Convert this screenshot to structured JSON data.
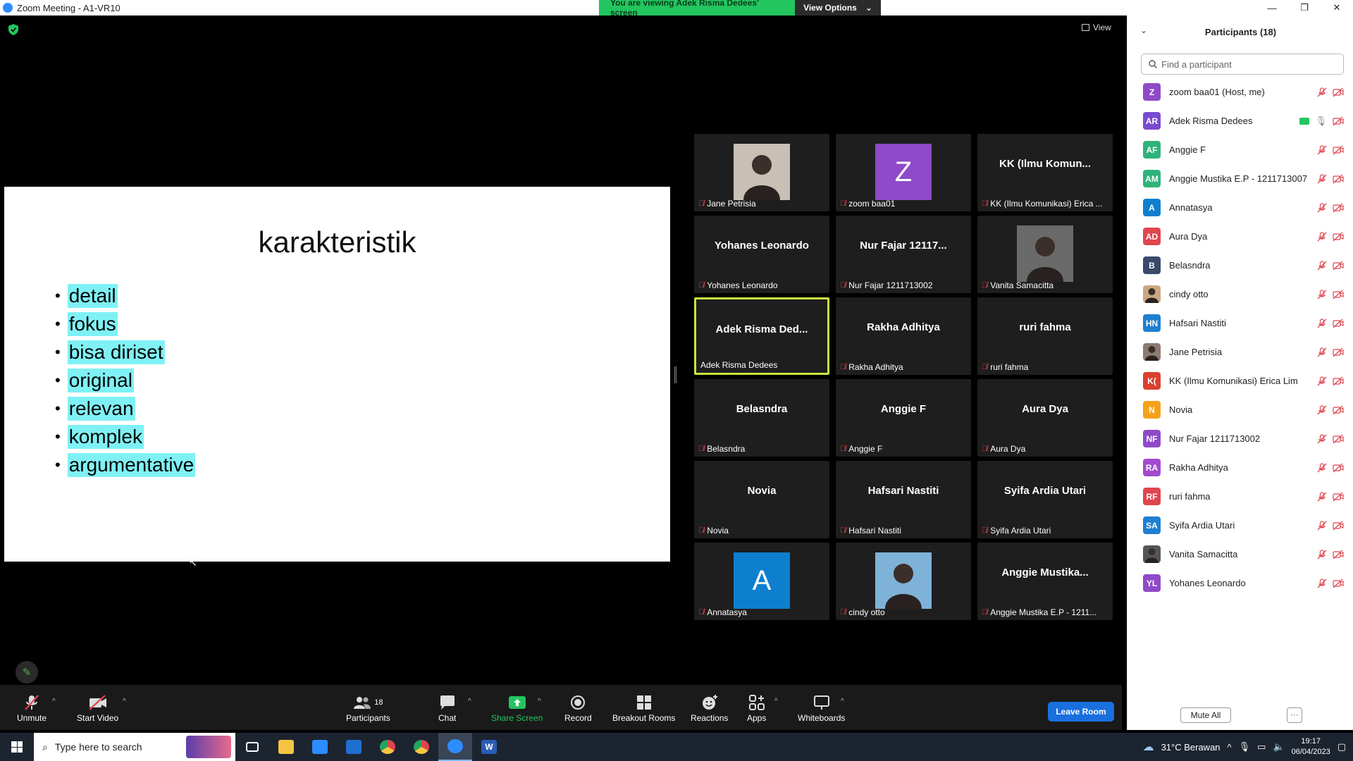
{
  "window": {
    "title": "Zoom Meeting - A1-VR10",
    "minimize": "—",
    "restore": "❐",
    "close": "✕"
  },
  "banner": {
    "viewing_text": "You are viewing Adek Risma Dedees' screen",
    "view_options": "View Options"
  },
  "view_button": "View",
  "slide": {
    "title": "karakteristik",
    "bullets": [
      "detail",
      "fokus",
      "bisa diriset",
      "original",
      "relevan",
      "komplek",
      "argumentative"
    ],
    "highlight_color": "#7ff1f5"
  },
  "gallery": [
    {
      "display": "",
      "label": "Jane Petrisia",
      "type": "photo"
    },
    {
      "display": "Z",
      "label": "zoom baa01",
      "type": "avatar",
      "color": "#8e4ac8"
    },
    {
      "display": "KK (Ilmu Komun...",
      "label": "KK (Ilmu Komunikasi) Erica ...",
      "type": "name"
    },
    {
      "display": "Yohanes Leonardo",
      "label": "Yohanes Leonardo",
      "type": "name"
    },
    {
      "display": "Nur Fajar 12117...",
      "label": "Nur Fajar 1211713002",
      "type": "name"
    },
    {
      "display": "",
      "label": "Vanita Samacitta",
      "type": "photo"
    },
    {
      "display": "Adek Risma Ded...",
      "label": "Adek Risma Dedees",
      "type": "name",
      "active": true
    },
    {
      "display": "Rakha Adhitya",
      "label": "Rakha Adhitya",
      "type": "name"
    },
    {
      "display": "ruri fahma",
      "label": "ruri fahma",
      "type": "name"
    },
    {
      "display": "Belasndra",
      "label": "Belasndra",
      "type": "name"
    },
    {
      "display": "Anggie F",
      "label": "Anggie F",
      "type": "name"
    },
    {
      "display": "Aura Dya",
      "label": "Aura Dya",
      "type": "name"
    },
    {
      "display": "Novia",
      "label": "Novia",
      "type": "name"
    },
    {
      "display": "Hafsari Nastiti",
      "label": "Hafsari Nastiti",
      "type": "name"
    },
    {
      "display": "Syifa Ardia Utari",
      "label": "Syifa Ardia Utari",
      "type": "name"
    },
    {
      "display": "A",
      "label": "Annatasya",
      "type": "avatar",
      "color": "#0e7fcf"
    },
    {
      "display": "",
      "label": "cindy otto",
      "type": "photo"
    },
    {
      "display": "Anggie Mustika...",
      "label": "Anggie Mustika E.P - 1211...",
      "type": "name"
    }
  ],
  "toolbar": {
    "unmute": "Unmute",
    "start_video": "Start Video",
    "participants": "Participants",
    "participants_count": "18",
    "chat": "Chat",
    "share_screen": "Share Screen",
    "record": "Record",
    "breakout_rooms": "Breakout Rooms",
    "reactions": "Reactions",
    "apps": "Apps",
    "whiteboards": "Whiteboards",
    "leave_room": "Leave Room"
  },
  "panel": {
    "title": "Participants (18)",
    "search_placeholder": "Find a participant",
    "mute_all": "Mute All",
    "more": "···",
    "participants": [
      {
        "initials": "Z",
        "name": "zoom baa01 (Host, me)",
        "color": "#8e4ac8"
      },
      {
        "initials": "AR",
        "name": "Adek Risma Dedees",
        "color": "#7a4ad0",
        "sharing": true
      },
      {
        "initials": "AF",
        "name": "Anggie F",
        "color": "#2eb37a"
      },
      {
        "initials": "AM",
        "name": "Anggie Mustika E.P - 1211713007",
        "color": "#2eb37a"
      },
      {
        "initials": "A",
        "name": "Annatasya",
        "color": "#0e7fcf"
      },
      {
        "initials": "AD",
        "name": "Aura Dya",
        "color": "#e0454e"
      },
      {
        "initials": "B",
        "name": "Belasndra",
        "color": "#3a4a6a"
      },
      {
        "initials": "",
        "name": "cindy otto",
        "color": "#c9a880",
        "photo": true
      },
      {
        "initials": "HN",
        "name": "Hafsari Nastiti",
        "color": "#1f7fd0"
      },
      {
        "initials": "",
        "name": "Jane Petrisia",
        "color": "#8c7b70",
        "photo": true
      },
      {
        "initials": "K(",
        "name": "KK (Ilmu Komunikasi) Erica Lim",
        "color": "#d9402e"
      },
      {
        "initials": "N",
        "name": "Novia",
        "color": "#f5a11a"
      },
      {
        "initials": "NF",
        "name": "Nur Fajar 1211713002",
        "color": "#8e4ac8"
      },
      {
        "initials": "RA",
        "name": "Rakha Adhitya",
        "color": "#a34ad0"
      },
      {
        "initials": "RF",
        "name": "ruri fahma",
        "color": "#e0454e"
      },
      {
        "initials": "SA",
        "name": "Syifa Ardia Utari",
        "color": "#1f7fd0"
      },
      {
        "initials": "",
        "name": "Vanita Samacitta",
        "color": "#555555",
        "photo": true
      },
      {
        "initials": "YL",
        "name": "Yohanes Leonardo",
        "color": "#8e4ac8"
      }
    ]
  },
  "taskbar": {
    "search_placeholder": "Type here to search",
    "weather": "31°C  Berawan",
    "time": "19:17",
    "date": "06/04/2023"
  }
}
